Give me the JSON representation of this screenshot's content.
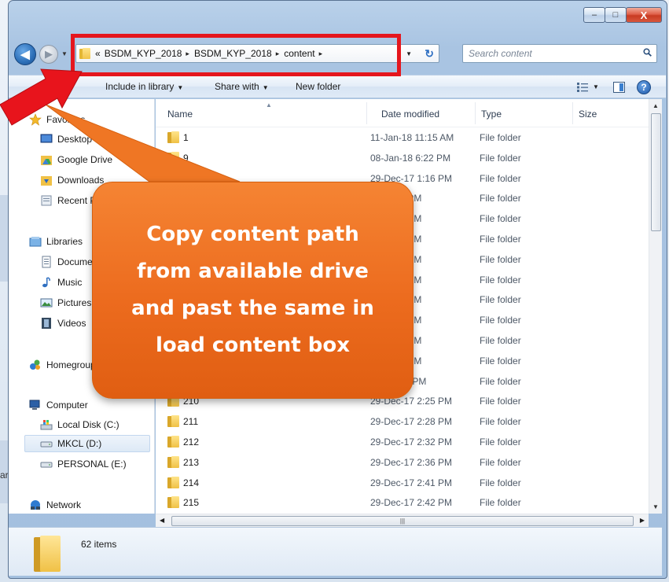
{
  "window": {
    "caption_buttons": {
      "minimize": "–",
      "maximize": "□",
      "close": "X"
    }
  },
  "address": {
    "back_glyph": "◀",
    "forward_glyph": "▶",
    "breadcrumbs": [
      "BSDM_KYP_2018",
      "BSDM_KYP_2018",
      "content"
    ],
    "overflow_glyph": "«",
    "separator": "▸"
  },
  "search": {
    "placeholder": "Search content"
  },
  "commandbar": {
    "include_label": "Include in library",
    "share_label": "Share with",
    "newfolder_label": "New folder",
    "help_glyph": "?"
  },
  "navpane": {
    "favorites": {
      "label": "Favorites",
      "items": [
        "Desktop",
        "Google Drive",
        "Downloads",
        "Recent Places"
      ]
    },
    "libraries": {
      "label": "Libraries",
      "items": [
        "Documents",
        "Music",
        "Pictures",
        "Videos"
      ]
    },
    "homegroup": {
      "label": "Homegroup"
    },
    "computer": {
      "label": "Computer",
      "items": [
        "Local Disk (C:)",
        "MKCL (D:)",
        "PERSONAL (E:)"
      ],
      "selected": "MKCL (D:)"
    },
    "network": {
      "label": "Network"
    }
  },
  "filelist": {
    "columns": {
      "name": "Name",
      "date": "Date modified",
      "type": "Type",
      "size": "Size"
    },
    "rows": [
      {
        "name": "1",
        "date": "11-Jan-18 11:15 AM",
        "type": "File folder"
      },
      {
        "name": "9",
        "date": "08-Jan-18 6:22 PM",
        "type": "File folder"
      },
      {
        "name": "",
        "date": "29-Dec-17 1:16 PM",
        "type": "File folder"
      },
      {
        "name": "",
        "date": "-18 6:20 PM",
        "type": "File folder"
      },
      {
        "name": "",
        "date": "-17 5:01 PM",
        "type": "File folder"
      },
      {
        "name": "",
        "date": "-17 2:01 PM",
        "type": "File folder"
      },
      {
        "name": "",
        "date": "-17 2:03 PM",
        "type": "File folder"
      },
      {
        "name": "",
        "date": "-17 2:08 PM",
        "type": "File folder"
      },
      {
        "name": "",
        "date": "-17 2:10 PM",
        "type": "File folder"
      },
      {
        "name": "",
        "date": "-17 2:12 PM",
        "type": "File folder"
      },
      {
        "name": "",
        "date": "-17 2:15 PM",
        "type": "File folder"
      },
      {
        "name": "",
        "date": "-17 2:17 PM",
        "type": "File folder"
      },
      {
        "name": "",
        "date": "c-17 2:22 PM",
        "type": "File folder"
      },
      {
        "name": "210",
        "date": "29-Dec-17 2:25 PM",
        "type": "File folder"
      },
      {
        "name": "211",
        "date": "29-Dec-17 2:28 PM",
        "type": "File folder"
      },
      {
        "name": "212",
        "date": "29-Dec-17 2:32 PM",
        "type": "File folder"
      },
      {
        "name": "213",
        "date": "29-Dec-17 2:36 PM",
        "type": "File folder"
      },
      {
        "name": "214",
        "date": "29-Dec-17 2:41 PM",
        "type": "File folder"
      },
      {
        "name": "215",
        "date": "29-Dec-17 2:42 PM",
        "type": "File folder"
      }
    ]
  },
  "details": {
    "count": "62 items"
  },
  "callout": {
    "lines": [
      "Copy content path",
      "from available drive",
      "and past the same in",
      "load content box"
    ],
    "color": "#ec6b1e"
  },
  "annotation": {
    "highlight_color": "#e5161d"
  },
  "peek": {
    "text": "ar"
  }
}
